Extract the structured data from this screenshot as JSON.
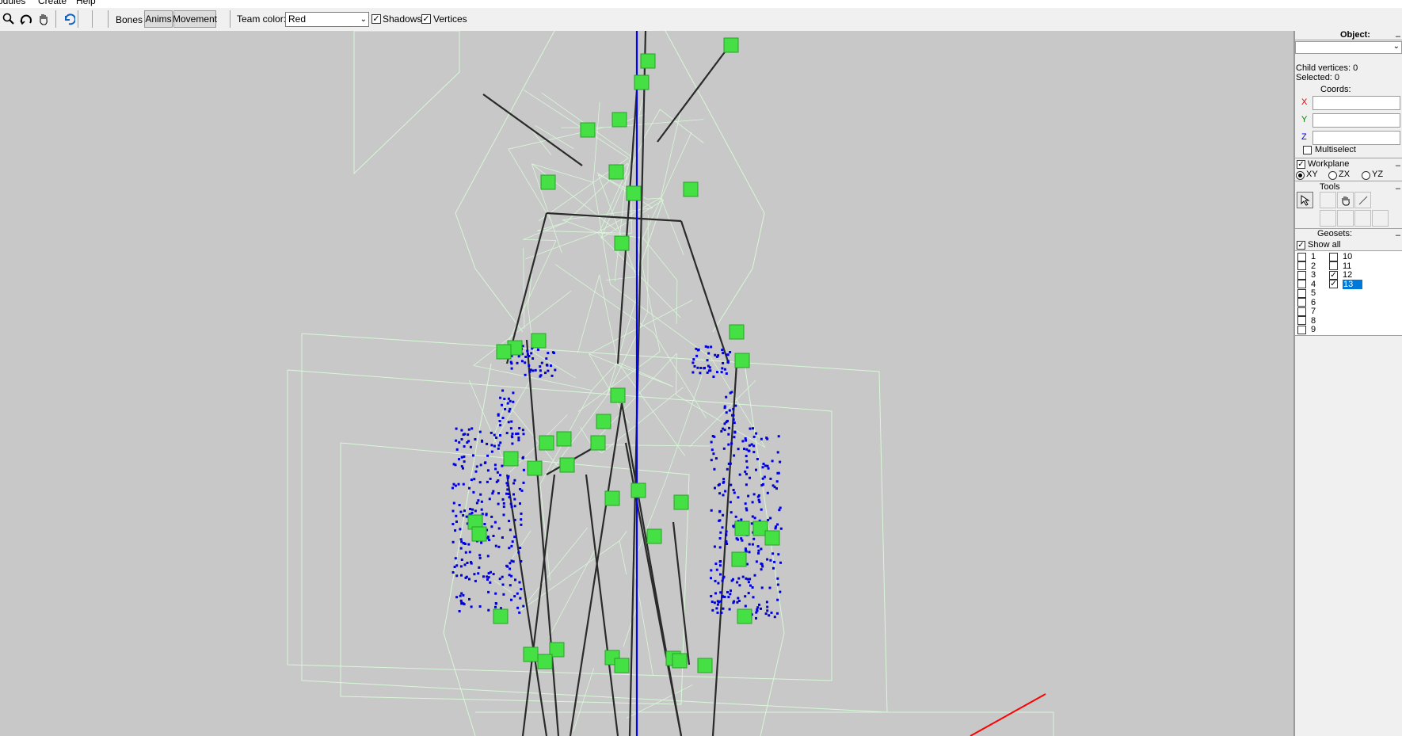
{
  "menu": {
    "items": [
      "odules",
      "Create",
      "Help"
    ]
  },
  "toolbar": {
    "tabs": [
      "Bones",
      "Anims",
      "Movement"
    ],
    "active_tab": "Bones",
    "team_color_label": "Team color:",
    "team_color_value": "Red",
    "shadows_label": "Shadows",
    "shadows_checked": true,
    "vertices_label": "Vertices",
    "vertices_checked": true,
    "icons": [
      "zoom-icon",
      "rotate-icon",
      "hand-icon",
      "undo-icon"
    ]
  },
  "panel": {
    "object_label": "Object:",
    "object_value": "",
    "child_vertices": "Child vertices: 0",
    "selected": "Selected: 0",
    "coords_label": "Coords:",
    "axes": [
      "X",
      "Y",
      "Z"
    ],
    "axis_colors": {
      "X": "#e00000",
      "Y": "#008000",
      "Z": "#0000e0"
    },
    "multiselect_label": "Multiselect",
    "workplane_label": "Workplane",
    "workplane_options": [
      "XY",
      "ZX",
      "YZ"
    ],
    "workplane_selected": "XY",
    "tools_label": "Tools",
    "geosets_label": "Geosets:",
    "show_all_label": "Show all",
    "geosets_left": [
      {
        "label": "1",
        "checked": false
      },
      {
        "label": "2",
        "checked": false
      },
      {
        "label": "3",
        "checked": false
      },
      {
        "label": "4",
        "checked": false
      },
      {
        "label": "5",
        "checked": false
      },
      {
        "label": "6",
        "checked": false
      },
      {
        "label": "7",
        "checked": false
      },
      {
        "label": "8",
        "checked": false
      },
      {
        "label": "9",
        "checked": false
      }
    ],
    "geosets_right": [
      {
        "label": "10",
        "checked": false
      },
      {
        "label": "11",
        "checked": false
      },
      {
        "label": "12",
        "checked": true
      },
      {
        "label": "13",
        "checked": true,
        "selected": true
      }
    ],
    "minus": "–"
  },
  "colors": {
    "viewport_bg": "#c8c8c8",
    "wire": "#d8f8d8",
    "bone": "#2a2a2a",
    "node": "#44e044",
    "vertex": "#0000dd",
    "axis_z": "#0000ff",
    "axis_x": "#ff0000",
    "highlight": "#0078d7"
  }
}
